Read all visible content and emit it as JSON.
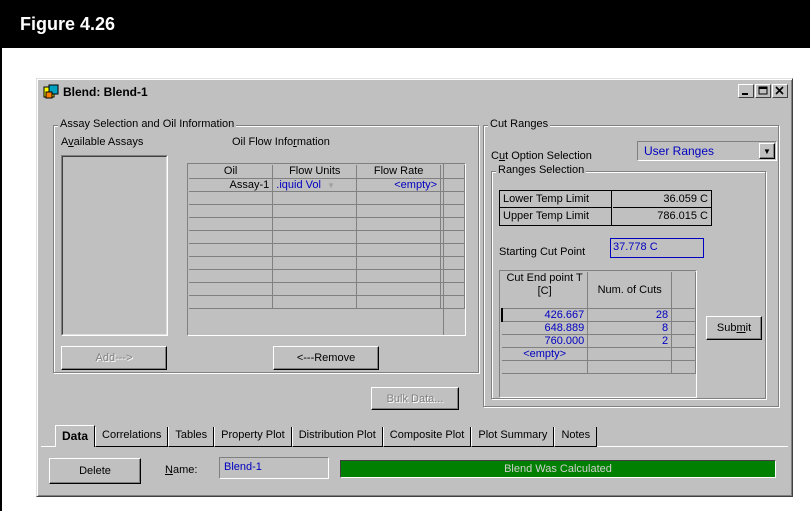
{
  "figure": {
    "title": "Figure 4.26"
  },
  "window": {
    "title": "Blend: Blend-1",
    "buttons": {
      "minimize": "_",
      "maximize": "□",
      "close": "×"
    }
  },
  "assay_group": {
    "legend": "Assay Selection and Oil Information",
    "available_label": "Available Assays",
    "oil_flow_label": "Oil Flow Information",
    "table": {
      "headers": [
        "Oil",
        "Flow Units",
        "Flow Rate"
      ],
      "rows": [
        [
          "Assay-1",
          ".iquid Vol",
          "<empty>"
        ],
        [
          "",
          "",
          ""
        ],
        [
          "",
          "",
          ""
        ],
        [
          "",
          "",
          ""
        ],
        [
          "",
          "",
          ""
        ],
        [
          "",
          "",
          ""
        ],
        [
          "",
          "",
          ""
        ],
        [
          "",
          "",
          ""
        ],
        [
          "",
          "",
          ""
        ],
        [
          "",
          "",
          ""
        ]
      ]
    },
    "add_button": "Add--->",
    "remove_button": "<---Remove"
  },
  "bulk_data_button": "Bulk Data...",
  "cut_ranges": {
    "legend": "Cut Ranges",
    "cut_option_label": "Cut Option Selection",
    "cut_option_value": "User Ranges",
    "ranges_legend": "Ranges Selection",
    "lower_label": "Lower Temp Limit",
    "lower_value": "36.059 C",
    "upper_label": "Upper Temp Limit",
    "upper_value": "786.015 C",
    "starting_label": "Starting Cut Point",
    "starting_value": "37.778 C",
    "table": {
      "headers": [
        "Cut End point T [C]",
        "Num. of Cuts"
      ],
      "rows": [
        [
          "426.667",
          "28"
        ],
        [
          "648.889",
          "8"
        ],
        [
          "760.000",
          "2"
        ],
        [
          "<empty>",
          ""
        ],
        [
          "",
          ""
        ]
      ]
    },
    "submit_button": "Submit"
  },
  "tabs": [
    "Data",
    "Correlations",
    "Tables",
    "Property Plot",
    "Distribution Plot",
    "Composite Plot",
    "Plot Summary",
    "Notes"
  ],
  "active_tab": "Data",
  "footer": {
    "delete_button": "Delete",
    "name_label": "Name:",
    "name_value": "Blend-1",
    "status": "Blend Was Calculated"
  },
  "colors": {
    "status_bg": "#008000",
    "value_text": "#0000c0",
    "dialog_bg": "#c0c0c0"
  },
  "icons": [
    "blend-icon",
    "minimize-icon",
    "maximize-icon",
    "close-icon",
    "dropdown-arrow-icon"
  ]
}
